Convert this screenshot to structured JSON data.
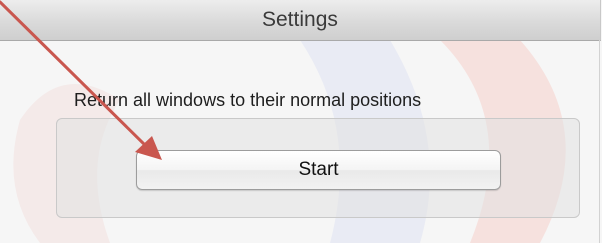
{
  "window": {
    "title": "Settings"
  },
  "content": {
    "description": "Return all windows to their normal positions",
    "start_label": "Start"
  },
  "annotation": {
    "arrow_color": "#c9574f"
  },
  "colors": {
    "watermark_red": "#f3d3cf",
    "watermark_blue": "#dcdff0"
  }
}
